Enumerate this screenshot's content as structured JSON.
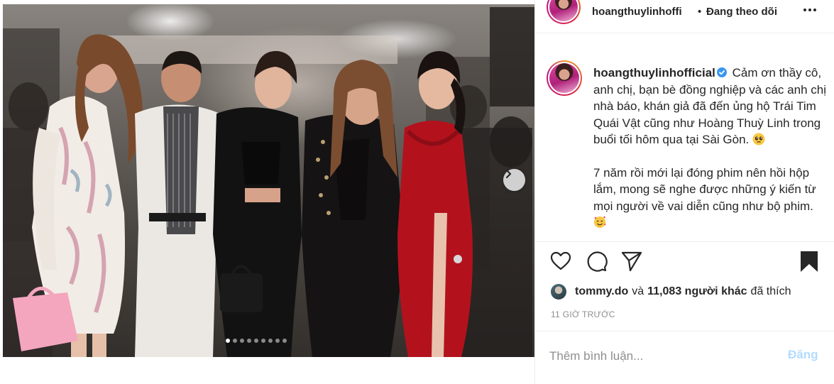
{
  "header": {
    "username": "hoangthuylinhoffi",
    "separator": "•",
    "follow_status": "Đang theo dõi",
    "more_icon": "more-horizontal-icon"
  },
  "caption": {
    "username": "hoangthuylinhofficial",
    "verified_icon": "verified-badge-icon",
    "paragraph1": "Cảm ơn thầy cô, anh chị, bạn bè đồng nghiệp và các anh chị nhà báo, khán giả đã đến ủng hộ Trái Tim Quái Vật cũng như Hoàng Thuỳ Linh trong buổi tối hôm qua tại Sài Gòn.",
    "paragraph1_emoji": "pleading-face-emoji",
    "paragraph2": "7 năm rồi mới lại đóng phim nên hồi hộp lắm, mong sẽ nghe được những ý kiến từ mọi người về vai diễn cũng như bộ phim.",
    "paragraph2_emoji": "smiling-face-with-hearts-emoji"
  },
  "actions": {
    "like_icon": "heart-icon",
    "comment_icon": "comment-icon",
    "share_icon": "share-icon",
    "save_icon": "bookmark-filled-icon"
  },
  "likes": {
    "liker": "tommy.do",
    "connector": "và",
    "count_text": "11,083 người khác",
    "suffix": "đã thích"
  },
  "timestamp": "11 GIỜ TRƯỚC",
  "comment": {
    "placeholder": "Thêm bình luận...",
    "post_label": "Đăng"
  },
  "carousel": {
    "slide_count": 9,
    "active_index": 0,
    "next_icon": "chevron-right-icon"
  },
  "colors": {
    "text": "#262626",
    "muted": "#8e8e8e",
    "verified": "#3897f0",
    "post_disabled": "#b3dbff",
    "border": "#efefef"
  }
}
